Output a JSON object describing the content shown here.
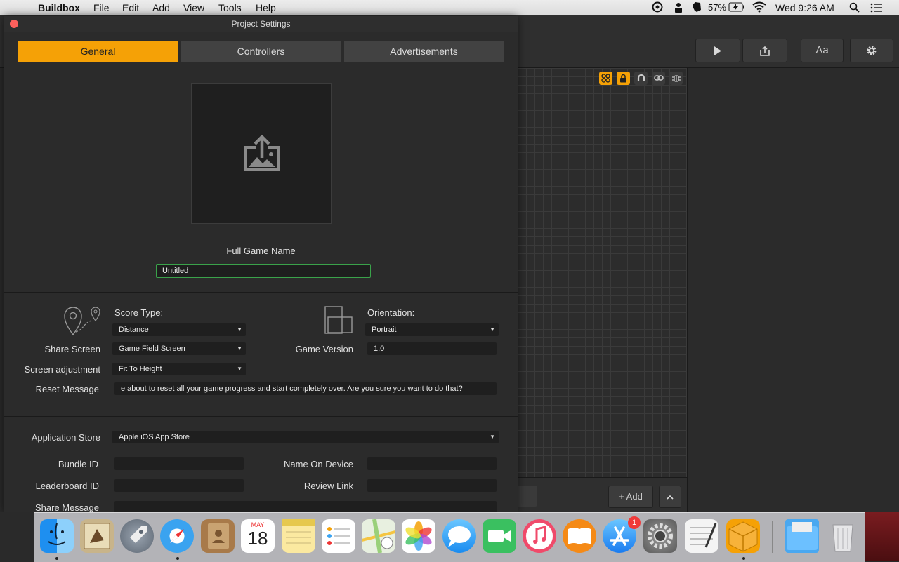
{
  "menubar": {
    "app_name": "Buildbox",
    "items": [
      "File",
      "Edit",
      "Add",
      "View",
      "Tools",
      "Help"
    ],
    "battery": "57%",
    "clock": "Wed 9:26 AM"
  },
  "toolbar": {
    "font_button": "Aa"
  },
  "canvas": {
    "add_button": "+ Add"
  },
  "window": {
    "title": "Project Settings",
    "tabs": [
      "General",
      "Controllers",
      "Advertisements"
    ],
    "full_game_name_label": "Full Game Name",
    "full_game_name_value": "Untitled",
    "score_type_label": "Score Type:",
    "score_type_value": "Distance",
    "orientation_label": "Orientation:",
    "orientation_value": "Portrait",
    "share_screen_label": "Share Screen",
    "share_screen_value": "Game Field Screen",
    "game_version_label": "Game Version",
    "game_version_value": "1.0",
    "screen_adjustment_label": "Screen adjustment",
    "screen_adjustment_value": "Fit To Height",
    "reset_message_label": "Reset Message",
    "reset_message_value": "e about to reset all your game progress and start completely over.  Are you sure you want to do that?",
    "application_store_label": "Application Store",
    "application_store_value": "Apple iOS App Store",
    "bundle_id_label": "Bundle ID",
    "name_on_device_label": "Name On Device",
    "leaderboard_id_label": "Leaderboard ID",
    "review_link_label": "Review Link",
    "share_message_label": "Share Message"
  },
  "dock": {
    "calendar_month": "MAY",
    "calendar_day": "18",
    "app_store_badge": "1"
  }
}
